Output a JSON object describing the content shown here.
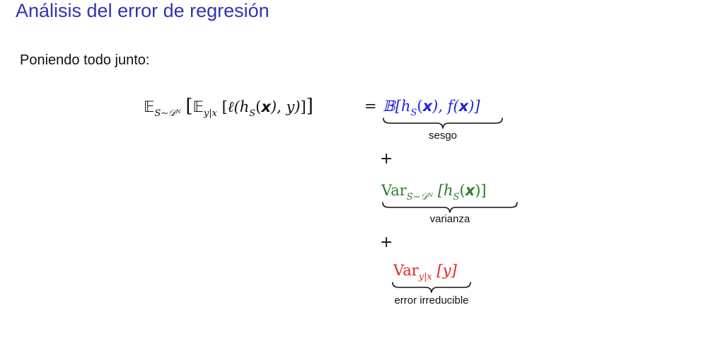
{
  "slide": {
    "title": "Análisis del error de regresión",
    "intro": "Poniendo todo junto:"
  },
  "equation": {
    "lhs": {
      "expect_outer": "𝔼",
      "outer_sub": "S∼𝒟ᴺ",
      "open_big": "[",
      "expect_inner": "𝔼",
      "inner_sub": "y|x",
      "open_br": "[",
      "loss": "ℓ(h",
      "h_sub": "S",
      "arg_open": "(",
      "x": "x",
      "rest": "), y)",
      "close_br": "]",
      "close_big": "]"
    },
    "equals": "=",
    "bias": {
      "expr_prefix": "𝔹[h",
      "h_sub": "S",
      "mid1": "(",
      "x1": "x",
      "mid2": "), f(",
      "x2": "x",
      "suffix": ")]",
      "label": "sesgo",
      "color": "#2222dd"
    },
    "plus1": "+",
    "variance": {
      "var": "Var",
      "sub": "S∼𝒟ᴺ",
      "open": " [h",
      "h_sub": "S",
      "paren": "(",
      "x": "x",
      "close": ")]",
      "label": "varianza",
      "color": "#2a7d2a"
    },
    "plus2": "+",
    "noise": {
      "var": "Var",
      "sub": "y|x",
      "expr": " [y]",
      "label": "error irreducible",
      "color": "#ee2222"
    }
  }
}
